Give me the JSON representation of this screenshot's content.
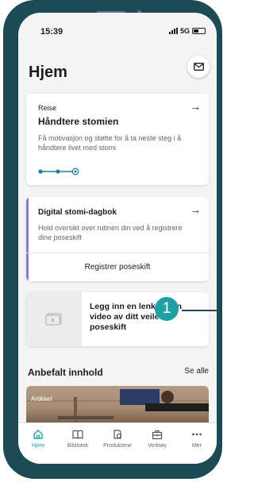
{
  "status_bar": {
    "time": "15:39",
    "network": "5G"
  },
  "header": {
    "title": "Hjem",
    "mail_icon": "mail-icon"
  },
  "travel_card": {
    "eyebrow": "Reise",
    "title": "Håndtere stomien",
    "description": "Få motivasjon og støtte for å ta neste steg i å håndtere livet med stomi",
    "progress_steps_done": 2,
    "progress_steps_total": 3
  },
  "diary_card": {
    "title": "Digital stomi-dagbok",
    "description": "Hold oversikt over rutinen din ved å registrere dine poseskift",
    "action_label": "Registrer poseskift",
    "accent_color": "#8e7cc3"
  },
  "video_card": {
    "text": "Legg inn en lenke til en video av ditt veiledet poseskift",
    "thumb_icon": "video-icon"
  },
  "annotation": {
    "badge": "1",
    "color": "#1fa0a5"
  },
  "recommended": {
    "title": "Anbefalt innhold",
    "see_all": "Se alle",
    "item_tag": "Artikkel"
  },
  "bottom_nav": {
    "active_color": "#1fa0a5",
    "items": [
      {
        "label": "Hjem",
        "icon": "home-icon"
      },
      {
        "label": "Bibliotek",
        "icon": "book-icon"
      },
      {
        "label": "Produktene",
        "icon": "products-icon"
      },
      {
        "label": "Verktøy",
        "icon": "toolbox-icon"
      },
      {
        "label": "Mer",
        "icon": "more-icon"
      }
    ]
  }
}
